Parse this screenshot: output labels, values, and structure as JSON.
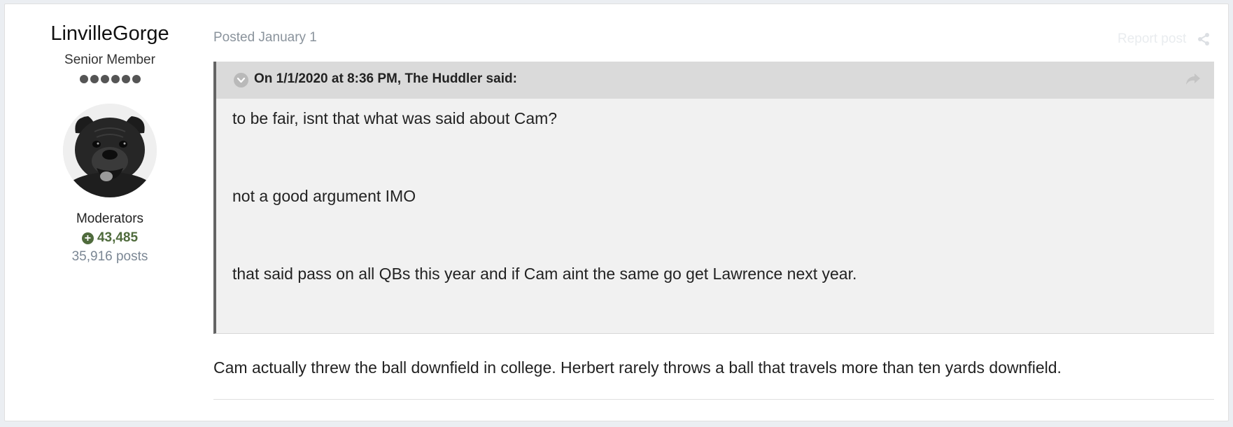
{
  "author": {
    "name": "LinvilleGorge",
    "title": "Senior Member",
    "rank_pips": 6,
    "group": "Moderators",
    "reputation": "43,485",
    "post_count": "35,916 posts"
  },
  "post": {
    "posted_label": "Posted January 1",
    "report_label": "Report post",
    "share_icon": "share-icon",
    "quote": {
      "citation": "On 1/1/2020 at 8:36 PM, The Huddler said:",
      "toggle_icon": "chevron-down-icon",
      "share_icon": "reply-arrow-icon",
      "paragraphs": [
        "to be fair, isnt that what was said about Cam?",
        "not a good argument IMO",
        "that said pass on all QBs this year and if Cam aint the same go get Lawrence next year."
      ]
    },
    "body": "Cam actually threw the ball downfield in college. Herbert rarely throws a ball that travels more than ten yards downfield."
  },
  "colors": {
    "reputation": "#4f6b3c",
    "quote_border": "#646464",
    "quote_bg": "#f1f1f1",
    "quote_header_bg": "#dadada"
  }
}
